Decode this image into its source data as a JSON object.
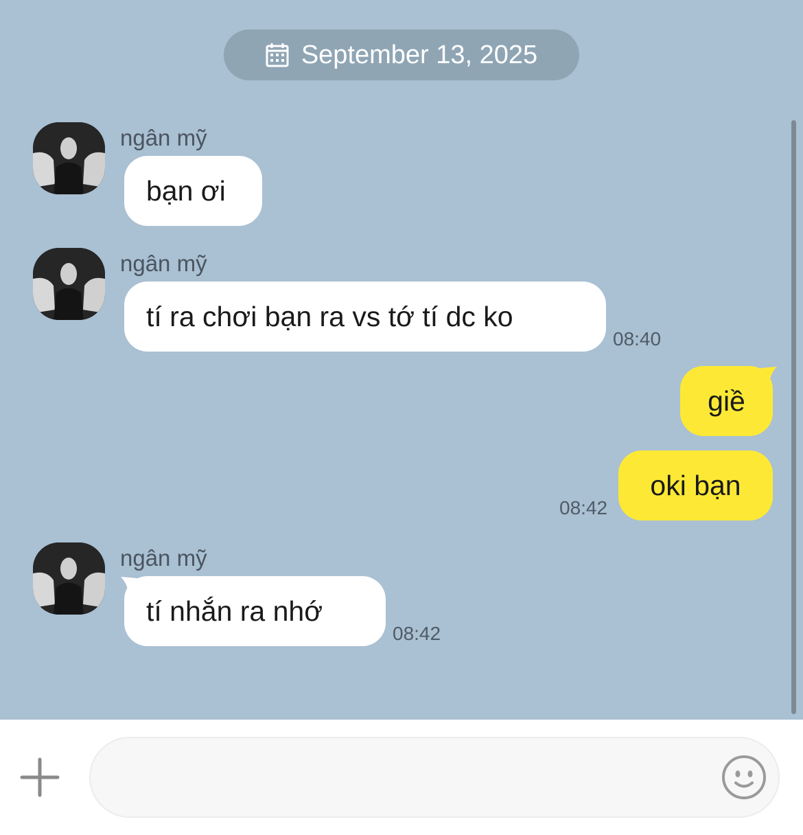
{
  "date_separator": {
    "icon": "calendar-icon",
    "text": "September 13, 2025"
  },
  "messages": [
    {
      "direction": "incoming",
      "sender": "ngân mỹ",
      "text": "bạn ơi",
      "time": ""
    },
    {
      "direction": "incoming",
      "sender": "ngân mỹ",
      "text": "tí ra chơi bạn ra vs tớ tí dc ko",
      "time": "08:40"
    },
    {
      "direction": "outgoing",
      "text": "giề",
      "time": ""
    },
    {
      "direction": "outgoing",
      "text": "oki bạn",
      "time": "08:42"
    },
    {
      "direction": "incoming",
      "sender": "ngân mỹ",
      "text": "tí nhắn ra nhớ",
      "time": "08:42"
    }
  ],
  "composer": {
    "plus_icon": "plus-icon",
    "input_value": "",
    "input_placeholder": "",
    "emoji_icon": "smiley-icon"
  },
  "colors": {
    "chat_background": "#aac0d3",
    "date_pill": "#8fa5b4",
    "incoming_bubble": "#ffffff",
    "outgoing_bubble": "#fde935",
    "composer_background": "#ffffff"
  }
}
